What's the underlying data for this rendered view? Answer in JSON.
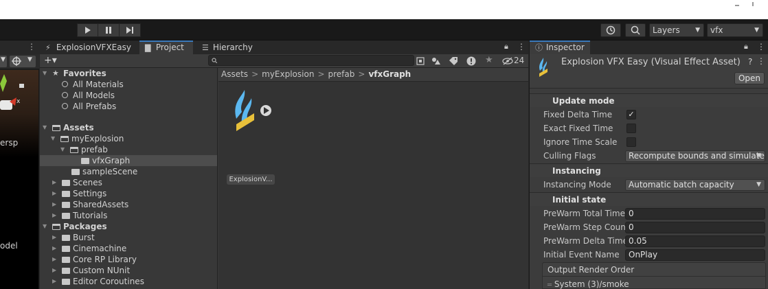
{
  "colors": {
    "accent": "#3a79bb",
    "vfx_blue": "#5bb8f0",
    "vfx_yellow": "#e8c03a"
  },
  "toolbar": {
    "play_icon": "play-icon",
    "pause_icon": "pause-icon",
    "step_icon": "step-icon",
    "history_icon": "history-icon",
    "search_icon": "search-icon",
    "layers_label": "Layers",
    "layout_label": "vfx"
  },
  "scene_panel": {
    "label_persp": "ersp",
    "label_model": "odel"
  },
  "project_panel": {
    "tabs": [
      {
        "label": "ExplosionVFXEasy",
        "icon": "vfx-graph-icon"
      },
      {
        "label": "Project",
        "icon": "folder-icon"
      },
      {
        "label": "Hierarchy",
        "icon": "list-icon"
      }
    ],
    "add_label": "+▾",
    "hidden_count": "24",
    "tree": {
      "favorites": "Favorites",
      "fav_items": [
        "All Materials",
        "All Models",
        "All Prefabs"
      ],
      "assets": "Assets",
      "my_explosion": "myExplosion",
      "prefab": "prefab",
      "vfx_graph": "vfxGraph",
      "sample_scene": "sampleScene",
      "scenes": "Scenes",
      "settings": "Settings",
      "shared_assets": "SharedAssets",
      "tutorials": "Tutorials",
      "packages": "Packages",
      "package_items": [
        "Burst",
        "Cinemachine",
        "Core RP Library",
        "Custom NUnit",
        "Editor Coroutines"
      ]
    },
    "breadcrumb": [
      "Assets",
      "myExplosion",
      "prefab",
      "vfxGraph"
    ],
    "asset_label": "ExplosionV..."
  },
  "inspector": {
    "tab_label": "Inspector",
    "title": "Explosion VFX Easy (Visual Effect Asset)",
    "open_button": "Open",
    "update_mode": {
      "header": "Update mode",
      "fixed_delta_label": "Fixed Delta Time",
      "fixed_delta_checked": "✓",
      "exact_fixed_label": "Exact Fixed Time",
      "ignore_scale_label": "Ignore Time Scale",
      "culling_label": "Culling Flags",
      "culling_value": "Recompute bounds and simulate"
    },
    "instancing": {
      "header": "Instancing",
      "mode_label": "Instancing Mode",
      "mode_value": "Automatic batch capacity"
    },
    "initial_state": {
      "header": "Initial state",
      "prewarm_total_label": "PreWarm Total Time",
      "prewarm_total_value": "0",
      "prewarm_step_label": "PreWarm Step Count",
      "prewarm_step_value": "0",
      "prewarm_delta_label": "PreWarm Delta Time",
      "prewarm_delta_value": "0.05",
      "event_name_label": "Initial Event Name",
      "event_name_value": "OnPlay"
    },
    "output_order_label": "Output Render Order",
    "output_item": "System (3)/smoke"
  }
}
